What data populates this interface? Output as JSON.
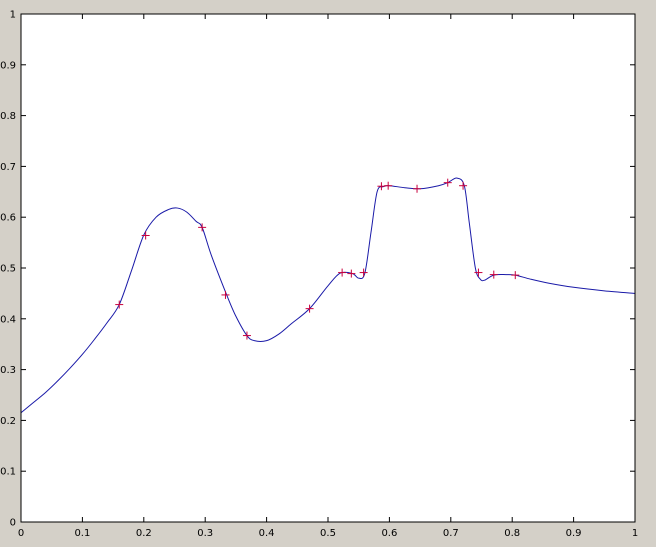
{
  "chart_data": {
    "type": "line",
    "title": "",
    "xlabel": "",
    "ylabel": "",
    "xlim": [
      0,
      1
    ],
    "ylim": [
      0,
      1
    ],
    "grid": false,
    "x_ticks": [
      "0",
      "0.1",
      "0.2",
      "0.3",
      "0.4",
      "0.5",
      "0.6",
      "0.7",
      "0.8",
      "0.9",
      "1"
    ],
    "y_ticks": [
      "0",
      "0.1",
      "0.2",
      "0.3",
      "0.4",
      "0.5",
      "0.6",
      "0.7",
      "0.8",
      "0.9",
      "1"
    ],
    "series": [
      {
        "kind": "curve",
        "color": "#1a1aa8",
        "x": [
          0.0,
          0.02,
          0.04,
          0.06,
          0.08,
          0.1,
          0.12,
          0.14,
          0.16,
          0.18,
          0.2,
          0.22,
          0.24,
          0.255,
          0.27,
          0.285,
          0.295,
          0.31,
          0.335,
          0.35,
          0.368,
          0.38,
          0.4,
          0.42,
          0.44,
          0.47,
          0.5,
          0.52,
          0.54,
          0.55,
          0.56,
          0.57,
          0.58,
          0.59,
          0.6,
          0.625,
          0.65,
          0.68,
          0.695,
          0.71,
          0.722,
          0.73,
          0.74,
          0.748,
          0.755,
          0.77,
          0.79,
          0.805,
          0.83,
          0.86,
          0.9,
          0.95,
          1.0
        ],
        "y": [
          0.215,
          0.235,
          0.255,
          0.278,
          0.303,
          0.33,
          0.36,
          0.392,
          0.428,
          0.495,
          0.565,
          0.6,
          0.615,
          0.618,
          0.61,
          0.592,
          0.58,
          0.525,
          0.447,
          0.405,
          0.367,
          0.357,
          0.357,
          0.37,
          0.39,
          0.42,
          0.465,
          0.49,
          0.489,
          0.48,
          0.49,
          0.57,
          0.65,
          0.66,
          0.662,
          0.658,
          0.656,
          0.662,
          0.668,
          0.677,
          0.662,
          0.59,
          0.5,
          0.478,
          0.476,
          0.486,
          0.487,
          0.486,
          0.478,
          0.47,
          0.462,
          0.455,
          0.45
        ]
      },
      {
        "kind": "markers",
        "color": "#c8003c",
        "marker": "+",
        "x": [
          0.16,
          0.203,
          0.295,
          0.333,
          0.368,
          0.47,
          0.523,
          0.538,
          0.558,
          0.587,
          0.598,
          0.645,
          0.695,
          0.72,
          0.745,
          0.77,
          0.805
        ],
        "y": [
          0.428,
          0.564,
          0.58,
          0.447,
          0.367,
          0.42,
          0.491,
          0.489,
          0.491,
          0.661,
          0.662,
          0.656,
          0.668,
          0.662,
          0.491,
          0.487,
          0.486
        ]
      }
    ]
  },
  "colors": {
    "figure_background": "#d4d0c8",
    "axes_background": "#ffffff",
    "axes_frame": "#000000",
    "curve": "#1a1aa8",
    "markers": "#c8003c"
  }
}
